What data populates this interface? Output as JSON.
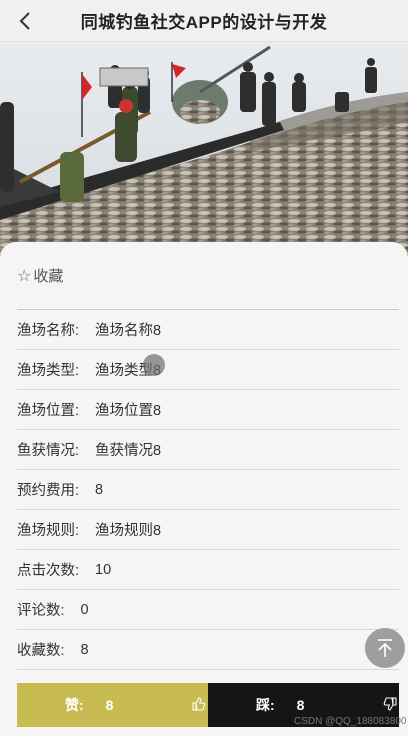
{
  "header": {
    "title": "同城钓鱼社交APP的设计与开发"
  },
  "favorite": {
    "label": "收藏"
  },
  "details": [
    {
      "label": "渔场名称:",
      "value": "渔场名称8"
    },
    {
      "label": "渔场类型:",
      "value": "渔场类型8"
    },
    {
      "label": "渔场位置:",
      "value": "渔场位置8"
    },
    {
      "label": "鱼获情况:",
      "value": "鱼获情况8"
    },
    {
      "label": "预约费用:",
      "value": "8"
    },
    {
      "label": "渔场规则:",
      "value": "渔场规则8"
    },
    {
      "label": "点击次数:",
      "value": "10"
    },
    {
      "label": "评论数:",
      "value": "0"
    },
    {
      "label": "收藏数:",
      "value": "8"
    }
  ],
  "actions": {
    "like": {
      "label": "赞:",
      "count": "8"
    },
    "dislike": {
      "label": "踩:",
      "count": "8"
    }
  },
  "watermark": "CSDN @QQ_188083800",
  "colors": {
    "like_bg": "#c8bb52",
    "dislike_bg": "#151515",
    "header_bg": "#f0f0f0"
  },
  "icons": {
    "back": "chevron-left-icon",
    "favorite": "star-outline-icon",
    "like": "thumbs-up-icon",
    "dislike": "thumbs-down-icon",
    "scroll_top": "arrow-up-to-top-icon"
  }
}
